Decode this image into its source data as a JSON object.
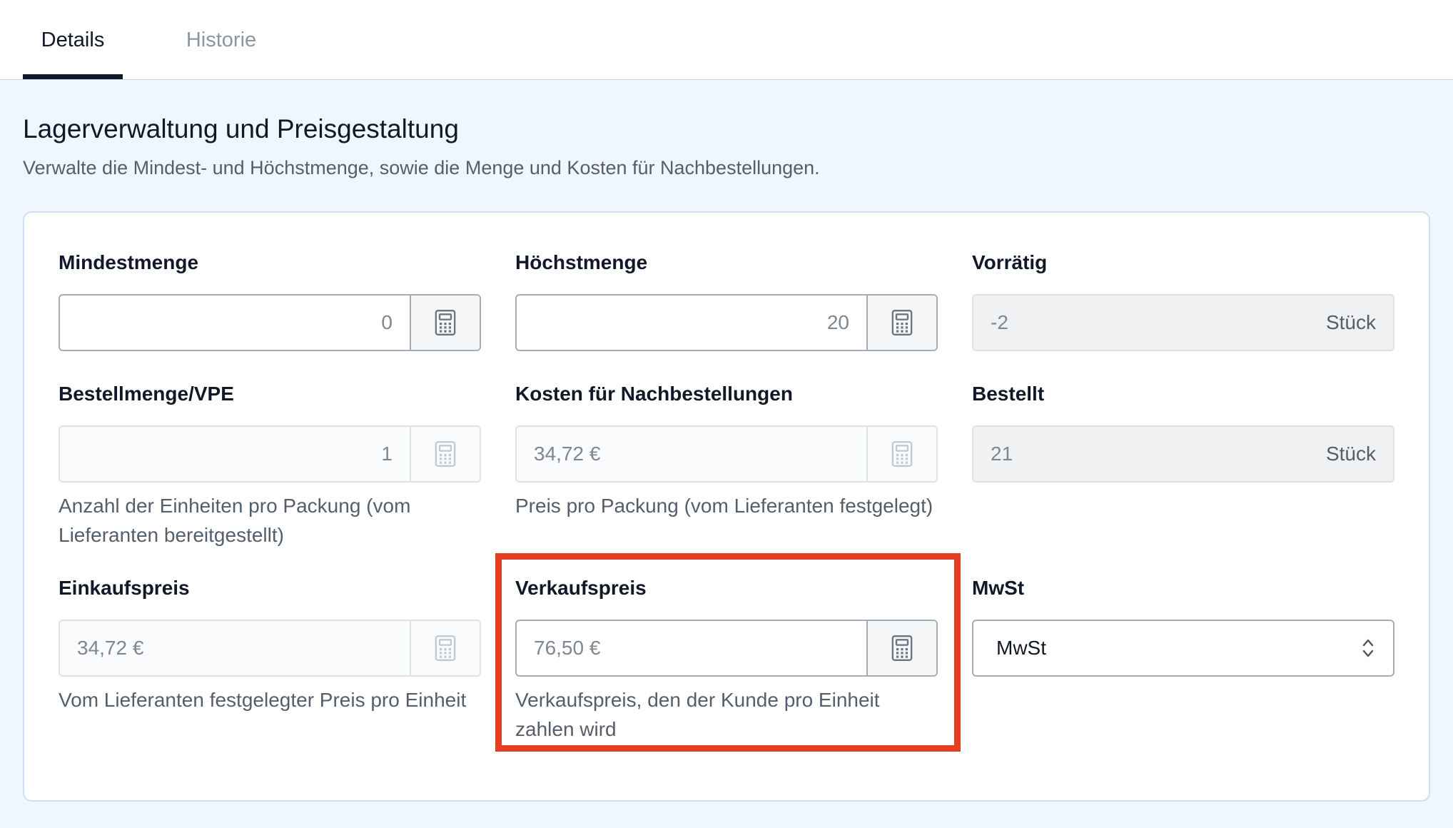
{
  "tabs": [
    {
      "label": "Details",
      "active": true
    },
    {
      "label": "Historie",
      "active": false
    }
  ],
  "section": {
    "title": "Lagerverwaltung und Preisgestaltung",
    "description": "Verwalte die Mindest- und Höchstmenge, sowie die Menge und Kosten für Nachbestellungen."
  },
  "fields": {
    "min_qty": {
      "label": "Mindestmenge",
      "value": "0"
    },
    "max_qty": {
      "label": "Höchstmenge",
      "value": "20"
    },
    "in_stock": {
      "label": "Vorrätig",
      "value": "-2",
      "unit": "Stück"
    },
    "order_qty": {
      "label": "Bestellmenge/VPE",
      "value": "1",
      "helper": "Anzahl der Einheiten pro Packung (vom Lieferanten bereitgestellt)"
    },
    "reorder_cost": {
      "label": "Kosten für Nachbestellungen",
      "value": "34,72 €",
      "helper": "Preis pro Packung (vom Lieferanten festgelegt)"
    },
    "ordered": {
      "label": "Bestellt",
      "value": "21",
      "unit": "Stück"
    },
    "purchase_price": {
      "label": "Einkaufspreis",
      "value": "34,72 €",
      "helper": "Vom Lieferanten festgelegter Preis pro Einheit"
    },
    "sale_price": {
      "label": "Verkaufspreis",
      "value": "76,50 €",
      "helper": "Verkaufspreis, den der Kunde pro Einheit zahlen wird"
    },
    "vat": {
      "label": "MwSt",
      "value": "MwSt"
    }
  },
  "icons": {
    "calculator": "calculator-icon",
    "select": "chevron-up-down-icon"
  },
  "colors": {
    "highlight": "#e43f25",
    "page_background": "#eff6fd",
    "active_tab": "#111827"
  }
}
